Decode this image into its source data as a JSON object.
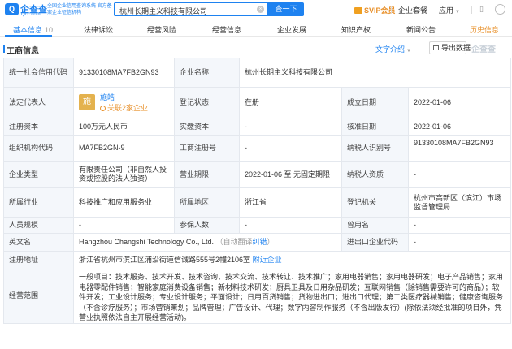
{
  "topbar": {
    "logo_mark": "Q",
    "logo_name": "企查查",
    "logo_url": "Qcc.com",
    "logo_sub": "全国企业信用查询系统 官方备案企业征信机构",
    "search_value": "杭州长期主义科技有限公司",
    "search_button": "查一下",
    "svip": "SVIP会员",
    "enterprise_suite": "企业套餐",
    "apps": "应用"
  },
  "tabs": [
    {
      "label": "基本信息",
      "count": "10"
    },
    {
      "label": "法律诉讼"
    },
    {
      "label": "经营风险"
    },
    {
      "label": "经营信息"
    },
    {
      "label": "企业发展"
    },
    {
      "label": "知识产权"
    },
    {
      "label": "新闻公告"
    },
    {
      "label": "历史信息"
    }
  ],
  "section": {
    "title": "工商信息",
    "intro": "文字介绍",
    "export": "导出数据",
    "watermark": "企查查"
  },
  "info": {
    "credit_code_label": "统一社会信用代码",
    "credit_code": "91330108MA7FB2GN93",
    "name_label": "企业名称",
    "name": "杭州长期主义科技有限公司",
    "legal_rep_label": "法定代表人",
    "legal_rep_avatar": "施",
    "legal_rep_name": "施皓",
    "legal_rep_relation": "关联2家企业",
    "status_label": "登记状态",
    "status": "在册",
    "founded_label": "成立日期",
    "founded": "2022-01-06",
    "reg_capital_label": "注册资本",
    "reg_capital": "100万元人民币",
    "paid_capital_label": "实缴资本",
    "paid_capital": "-",
    "approval_date_label": "核准日期",
    "approval_date": "2022-01-06",
    "org_code_label": "组织机构代码",
    "org_code": "MA7FB2GN-9",
    "biz_reg_no_label": "工商注册号",
    "biz_reg_no": "-",
    "taxpayer_id_label": "纳税人识别号",
    "taxpayer_id": "91330108MA7FB2GN93",
    "type_label": "企业类型",
    "type": "有限责任公司（非自然人投资或控股的法人独资）",
    "term_label": "营业期限",
    "term": "2022-01-06 至 无固定期限",
    "taxpayer_qual_label": "纳税人资质",
    "taxpayer_qual": "-",
    "industry_label": "所属行业",
    "industry": "科技推广和应用服务业",
    "region_label": "所属地区",
    "region": "浙江省",
    "authority_label": "登记机关",
    "authority": "杭州市高新区（滨江）市场监督管理局",
    "staff_size_label": "人员规模",
    "staff_size": "-",
    "insured_label": "参保人数",
    "insured": "-",
    "former_name_label": "曾用名",
    "former_name": "-",
    "english_name_label": "英文名",
    "english_name": "Hangzhou Changshi Technology Co., Ltd.",
    "english_note": "（自动翻译",
    "english_fix": "纠错",
    "english_note_end": "）",
    "import_export_label": "进出口企业代码",
    "import_export": "-",
    "address_label": "注册地址",
    "address": "浙江省杭州市滨江区浦沿街道信诚路555号2幢2106室",
    "address_link": "附近企业",
    "scope_label": "经营范围",
    "scope": "一般项目：技术服务、技术开发、技术咨询、技术交流、技术转让、技术推广；家用电器销售；家用电器研发；电子产品销售；家用电器零配件销售；智能家庭消费设备销售；新材料技术研发；厨具卫具及日用杂品研发；互联网销售（除销售需要许可的商品）；软件开发；工业设计服务；专业设计服务；平面设计；日用百货销售；货物进出口；进出口代理；第二类医疗器械销售；健康咨询服务（不含诊疗服务）；市场营销策划；品牌管理；广告设计、代理；数字内容制作服务（不含出版发行）(除依法须经批准的项目外，凭营业执照依法自主开展经营活动)。"
  }
}
